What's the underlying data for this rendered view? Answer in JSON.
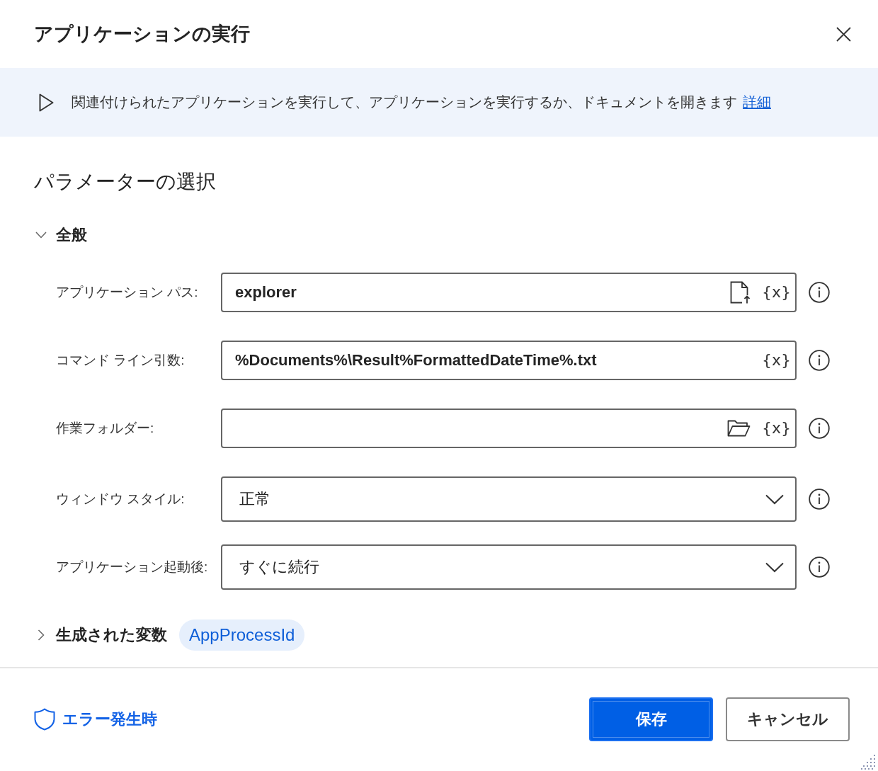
{
  "dialog": {
    "title": "アプリケーションの実行"
  },
  "info_banner": {
    "text": "関連付けられたアプリケーションを実行して、アプリケーションを実行するか、ドキュメントを開きます",
    "link": "詳細"
  },
  "parameters": {
    "heading": "パラメーターの選択",
    "general": {
      "title": "全般",
      "expanded": true,
      "fields": [
        {
          "kind": "text",
          "label": "アプリケーション パス:",
          "value": "explorer",
          "file_picker": true,
          "variable_button": "{x}"
        },
        {
          "kind": "text",
          "label": "コマンド ライン引数:",
          "value": "%Documents%\\Result%FormattedDateTime%.txt",
          "variable_button": "{x}"
        },
        {
          "kind": "text",
          "label": "作業フォルダー:",
          "folder_picker": true,
          "variable_button": "{x}"
        },
        {
          "kind": "dropdown",
          "label": "ウィンドウ スタイル:",
          "value": "正常"
        },
        {
          "kind": "dropdown",
          "label": "アプリケーション起動後:",
          "value": "すぐに続行"
        }
      ]
    },
    "generated_variables": {
      "title": "生成された変数",
      "expanded": false,
      "variables": [
        "AppProcessId"
      ]
    }
  },
  "footer": {
    "error_link": "エラー発生時",
    "buttons": [
      {
        "label": "保存",
        "kind": "primary"
      },
      {
        "label": "キャンセル",
        "kind": "secondary"
      }
    ]
  }
}
